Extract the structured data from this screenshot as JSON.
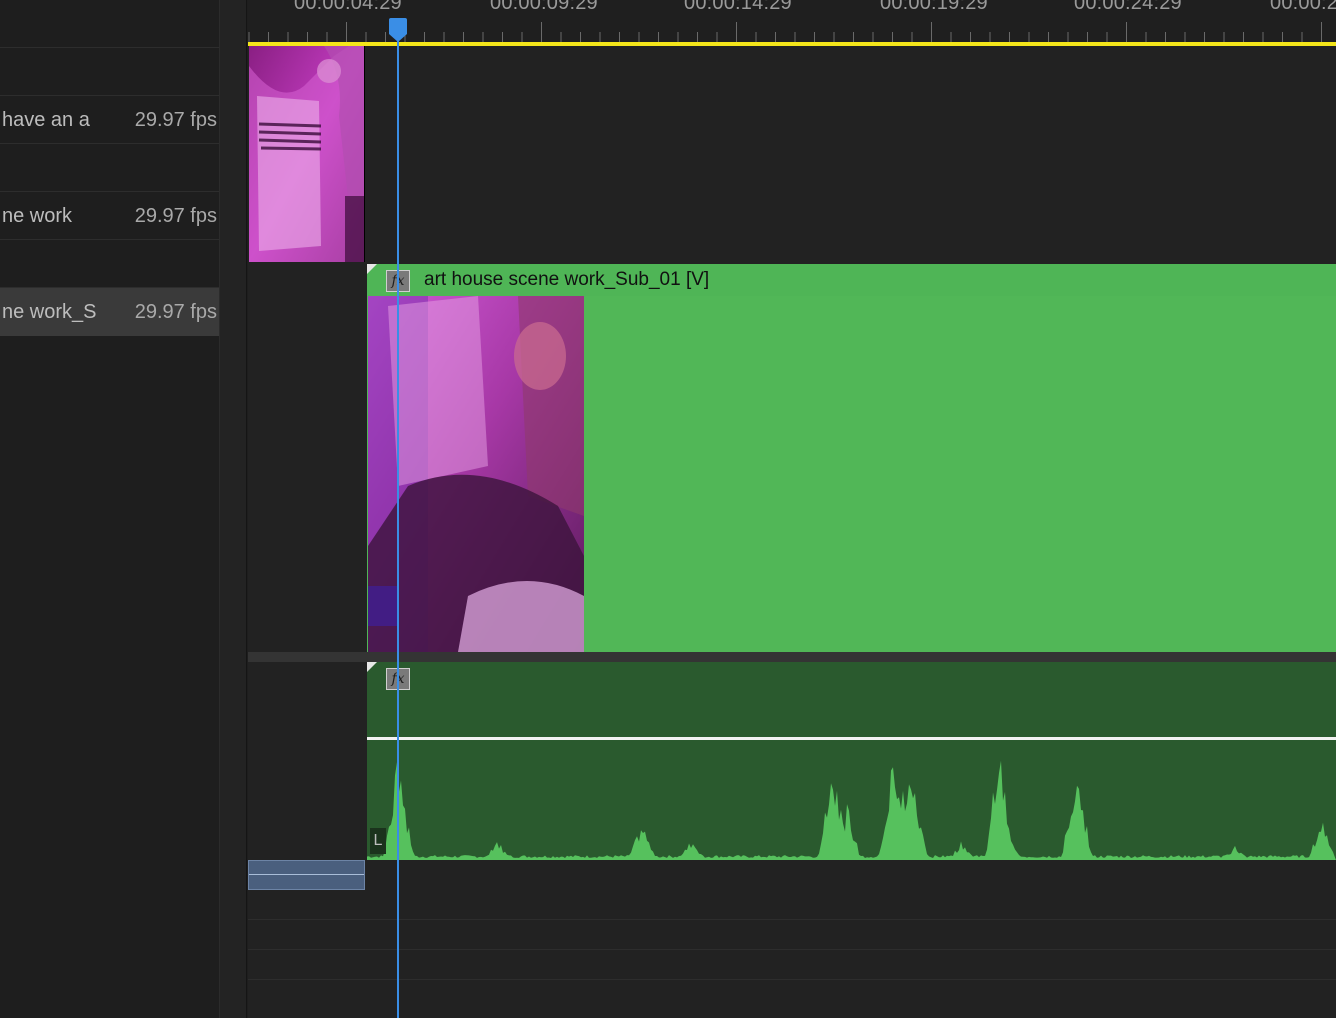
{
  "project_panel": {
    "rows": [
      {
        "name": "",
        "fps": ""
      },
      {
        "name": "have an a",
        "fps": "29.97 fps"
      },
      {
        "name": "",
        "fps": ""
      },
      {
        "name": "ne work",
        "fps": "29.97 fps"
      },
      {
        "name": "",
        "fps": ""
      },
      {
        "name": "ne work_S",
        "fps": "29.97 fps",
        "selected": true
      }
    ]
  },
  "timeline": {
    "timecodes": [
      "00:00:04:29",
      "00:00:09:29",
      "00:00:14:29",
      "00:00:19:29",
      "00:00:24:29",
      "00:00:2"
    ],
    "work_area_color": "#f4e61a",
    "playhead_color": "#3a8ee6",
    "video_track": {
      "clip_label": "art house scene work_Sub_01 [V]",
      "clip_color": "#51b757",
      "fx_badge": "fx"
    },
    "audio_track": {
      "fx_badge": "fx",
      "channel_label": "L",
      "clip_color": "#2a5a2e",
      "waveform_color": "#56c15d"
    }
  }
}
